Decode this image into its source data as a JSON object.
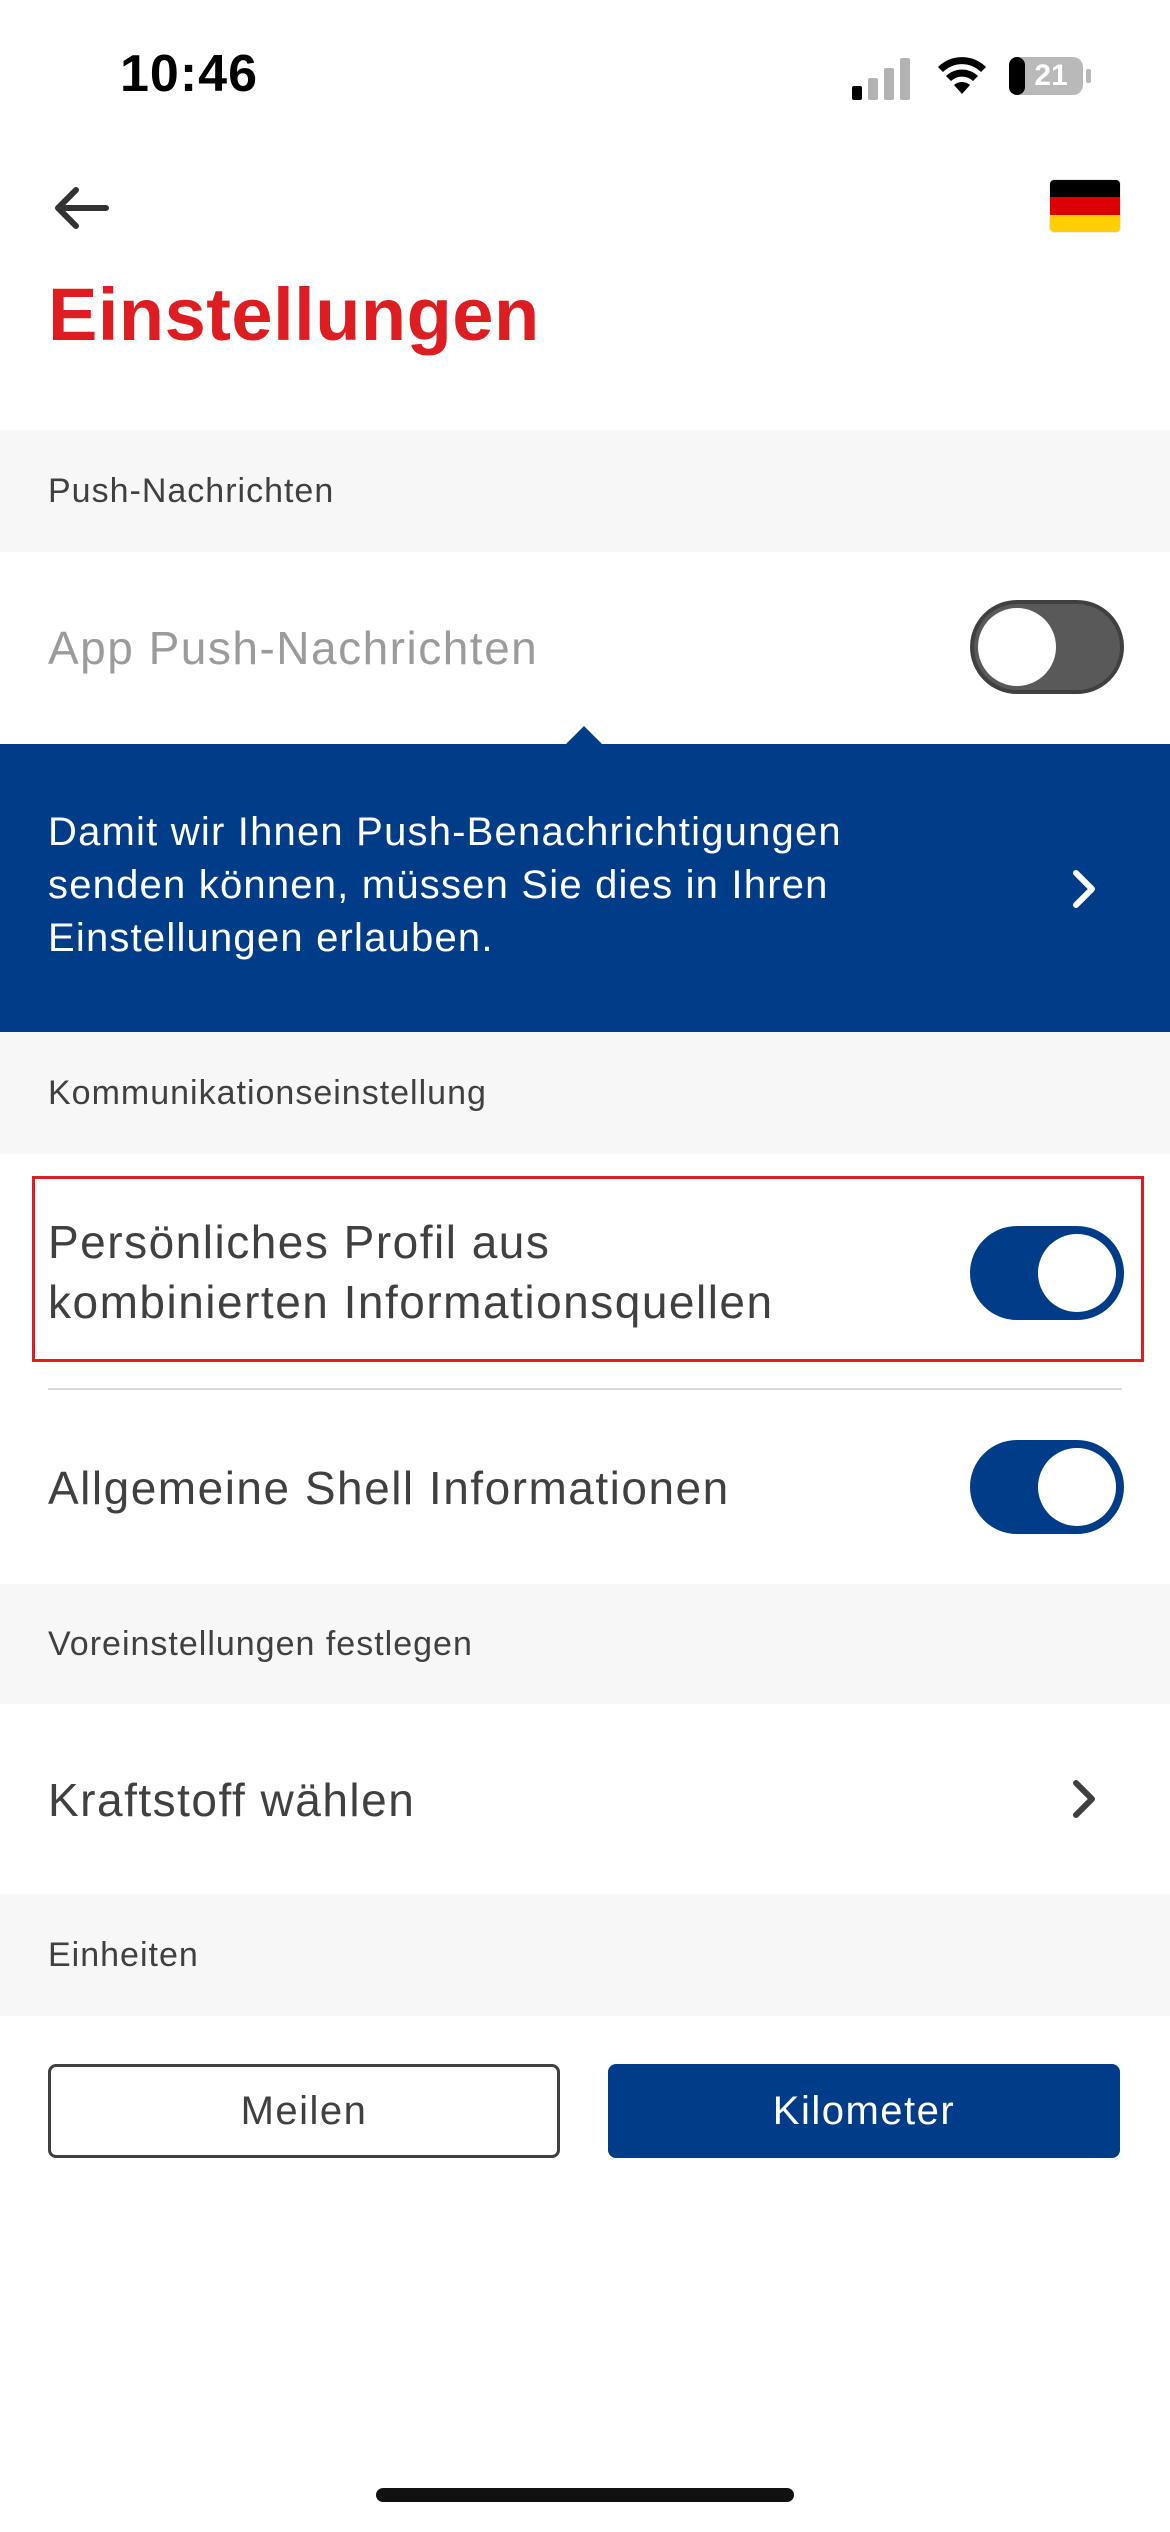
{
  "status_bar": {
    "time": "10:46",
    "battery_level": "21"
  },
  "header": {
    "title": "Einstellungen"
  },
  "sections": {
    "push": "Push-Nachrichten",
    "communication": "Kommunikationseinstellung",
    "presets": "Voreinstellungen festlegen",
    "units": "Einheiten"
  },
  "push": {
    "app_push_label": "App Push-Nachrichten",
    "app_push_enabled": false,
    "banner_text": "Damit wir Ihnen Push-Benachrichtigungen senden können, müssen Sie dies in Ihren Einstellungen erlauben."
  },
  "communication": {
    "profile_label_line1": "Persönliches Profil aus",
    "profile_label_line2": "kombinierten Informationsquellen",
    "profile_enabled": true,
    "general_label": "Allgemeine Shell Informationen",
    "general_enabled": true
  },
  "presets": {
    "fuel_label": "Kraftstoff wählen"
  },
  "units": {
    "miles_label": "Meilen",
    "km_label": "Kilometer",
    "selected": "Kilometer"
  },
  "colors": {
    "brand_red": "#dd1d21",
    "brand_blue": "#003c88",
    "section_bg": "#f7f7f7"
  },
  "icons": {
    "back": "arrow-left-icon",
    "flag": "germany-flag-icon",
    "chevron": "chevron-right-icon"
  }
}
